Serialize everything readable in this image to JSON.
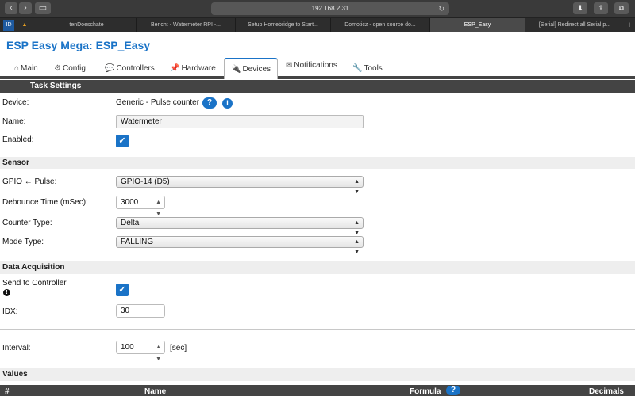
{
  "browser": {
    "address": "192.168.2.31",
    "tabs": [
      "tenDoeschate",
      "Bericht - Watermeter RPI -...",
      "Setup Homebridge to Start...",
      "Domoticz - open source do...",
      "ESP_Easy",
      "[Serial] Redirect all Serial.p..."
    ],
    "active_tab_index": 4
  },
  "app": {
    "title": "ESP Easy Mega: ESP_Easy"
  },
  "menu": {
    "items": [
      "Main",
      "Config",
      "Controllers",
      "Hardware",
      "Devices",
      "Notifications",
      "Tools"
    ],
    "icons": [
      "home-icon",
      "gear-icon",
      "speech-bubble-icon",
      "pin-icon",
      "plug-icon",
      "envelope-icon",
      "wrench-icon"
    ],
    "active": "Devices"
  },
  "task_settings": {
    "header": "Task Settings",
    "device_label": "Device:",
    "device_value": "Generic - Pulse counter",
    "help_glyph": "?",
    "info_glyph": "i",
    "name_label": "Name:",
    "name_value": "Watermeter",
    "enabled_label": "Enabled:",
    "enabled": true
  },
  "sensor": {
    "header": "Sensor",
    "gpio_label": "GPIO ← Pulse:",
    "gpio_value": "GPIO-14 (D5)",
    "debounce_label": "Debounce Time (mSec):",
    "debounce_value": "3000",
    "counter_type_label": "Counter Type:",
    "counter_type_value": "Delta",
    "mode_type_label": "Mode Type:",
    "mode_type_value": "FALLING"
  },
  "data_acquisition": {
    "header": "Data Acquisition",
    "send_label": "Send to Controller",
    "send_warn_glyph": "!",
    "send_enabled": true,
    "idx_label": "IDX:",
    "idx_value": "30",
    "interval_label": "Interval:",
    "interval_value": "100",
    "interval_unit": "[sec]"
  },
  "values": {
    "header": "Values",
    "columns": [
      "#",
      "Name",
      "Formula",
      "Decimals"
    ],
    "formula_help_glyph": "?"
  },
  "colors": {
    "accent": "#1a73c7",
    "section_dark": "#444444",
    "section_light": "#eeeeee"
  }
}
